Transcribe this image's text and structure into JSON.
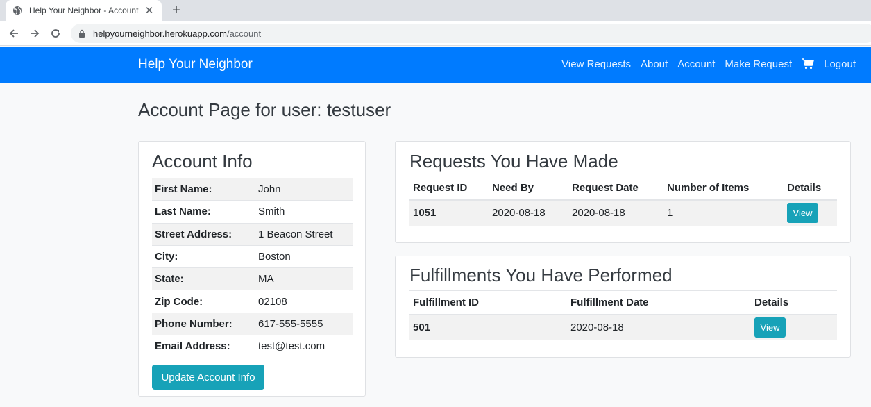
{
  "browser": {
    "tab_title": "Help Your Neighbor - Account",
    "url_host": "helpyourneighbor.herokuapp.com",
    "url_path": "/account"
  },
  "navbar": {
    "brand": "Help Your Neighbor",
    "links": [
      "View Requests",
      "About",
      "Account",
      "Make Request",
      "Logout"
    ],
    "color": "#007bff"
  },
  "page_title": "Account Page for user: testuser",
  "account_info": {
    "heading": "Account Info",
    "rows": [
      {
        "label": "First Name:",
        "value": "John"
      },
      {
        "label": "Last Name:",
        "value": "Smith"
      },
      {
        "label": "Street Address:",
        "value": "1 Beacon Street"
      },
      {
        "label": "City:",
        "value": "Boston"
      },
      {
        "label": "State:",
        "value": "MA"
      },
      {
        "label": "Zip Code:",
        "value": "02108"
      },
      {
        "label": "Phone Number:",
        "value": "617-555-5555"
      },
      {
        "label": "Email Address:",
        "value": "test@test.com"
      }
    ],
    "update_button": "Update Account Info"
  },
  "requests": {
    "heading": "Requests You Have Made",
    "columns": [
      "Request ID",
      "Need By",
      "Request Date",
      "Number of Items",
      "Details"
    ],
    "rows": [
      {
        "id": "1051",
        "need_by": "2020-08-18",
        "request_date": "2020-08-18",
        "items": "1",
        "button": "View"
      }
    ]
  },
  "fulfillments": {
    "heading": "Fulfillments You Have Performed",
    "columns": [
      "Fulfillment ID",
      "Fulfillment Date",
      "Details"
    ],
    "rows": [
      {
        "id": "501",
        "date": "2020-08-18",
        "button": "View"
      }
    ]
  },
  "icons": {
    "favicon": "globe-icon",
    "cart": "shopping-cart-icon",
    "lock": "lock-icon"
  },
  "button_color": "#17a2b8"
}
